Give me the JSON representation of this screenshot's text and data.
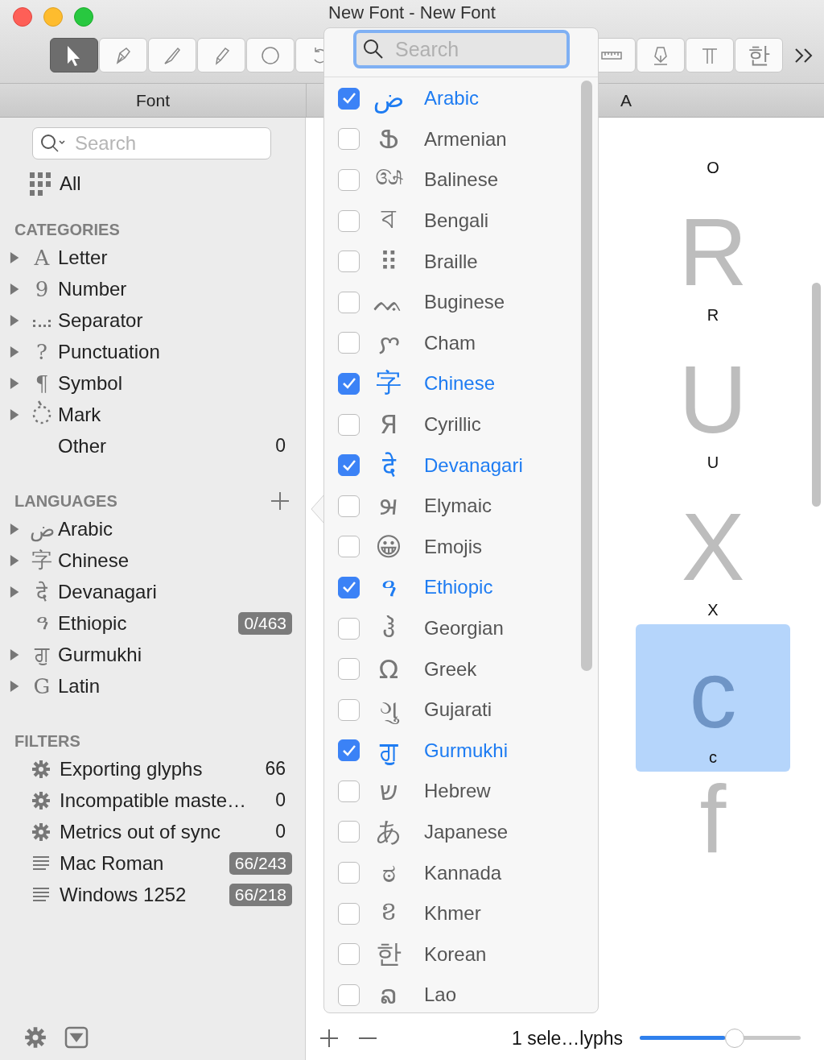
{
  "window": {
    "title": "New Font - New Font"
  },
  "toolbar": {
    "tools": [
      {
        "selected": true
      },
      {
        "selected": false
      },
      {
        "selected": false
      },
      {
        "selected": false
      },
      {
        "selected": false
      },
      {
        "selected": false
      },
      {
        "selected": false
      },
      {
        "selected": false
      },
      {
        "selected": false
      },
      {
        "glyph": "한",
        "selected": false
      }
    ]
  },
  "header": {
    "sidebar_title": "Font",
    "column_title": "A"
  },
  "sidebar": {
    "search": {
      "placeholder": "Search"
    },
    "all": {
      "label": "All"
    },
    "categories": {
      "title": "CATEGORIES",
      "items": [
        {
          "glyph": "A",
          "label": "Letter",
          "expanded": false
        },
        {
          "glyph": "9",
          "label": "Number",
          "expanded": false
        },
        {
          "label": "Separator",
          "expanded": false
        },
        {
          "glyph": "?",
          "label": "Punctuation",
          "expanded": false
        },
        {
          "glyph": "¶",
          "label": "Symbol",
          "expanded": false
        },
        {
          "label": "Mark",
          "expanded": false
        },
        {
          "label": "Other",
          "count": "0"
        }
      ]
    },
    "languages": {
      "title": "LANGUAGES",
      "items": [
        {
          "glyph": "ض",
          "label": "Arabic",
          "expanded": false
        },
        {
          "glyph": "字",
          "label": "Chinese",
          "expanded": false
        },
        {
          "glyph": "दे",
          "label": "Devanagari",
          "expanded": false
        },
        {
          "glyph": "ዓ",
          "label": "Ethiopic",
          "badge": "0/463"
        },
        {
          "glyph": "ਗੁ",
          "label": "Gurmukhi",
          "expanded": false
        },
        {
          "glyph": "G",
          "label": "Latin",
          "expanded": false
        }
      ]
    },
    "filters": {
      "title": "FILTERS",
      "items": [
        {
          "kind": "filter",
          "label": "Exporting glyphs",
          "count": "66"
        },
        {
          "kind": "filter",
          "label": "Incompatible maste…",
          "count": "0"
        },
        {
          "kind": "filter",
          "label": "Metrics out of sync",
          "count": "0"
        },
        {
          "kind": "encoding",
          "label": "Mac Roman",
          "badge": "66/243"
        },
        {
          "kind": "encoding",
          "label": "Windows 1252",
          "badge": "66/218"
        }
      ]
    }
  },
  "glyphs": [
    {
      "name": "O",
      "selected": false
    },
    {
      "glyph": "R",
      "name": "R",
      "selected": false
    },
    {
      "glyph": "U",
      "name": "U",
      "selected": false
    },
    {
      "glyph": "X",
      "name": "X",
      "selected": false
    },
    {
      "glyph": "c",
      "name": "c",
      "selected": true
    },
    {
      "glyph": "f",
      "selected": false
    }
  ],
  "status_bar": {
    "text": "1 sele…lyphs",
    "zoom": {
      "level": 0.59
    }
  },
  "popover": {
    "search": {
      "placeholder": "Search"
    },
    "scripts": [
      {
        "glyph": "ض",
        "name": "Arabic",
        "checked": true
      },
      {
        "glyph": "Ֆ",
        "name": "Armenian",
        "checked": false
      },
      {
        "glyph": "ᬅ",
        "name": "Balinese",
        "checked": false
      },
      {
        "glyph": "ব",
        "name": "Bengali",
        "checked": false
      },
      {
        "glyph": "⠿",
        "name": "Braille",
        "checked": false
      },
      {
        "glyph": "ᨕ",
        "name": "Buginese",
        "checked": false
      },
      {
        "glyph": "ꨆ",
        "name": "Cham",
        "checked": false
      },
      {
        "glyph": "字",
        "name": "Chinese",
        "checked": true
      },
      {
        "glyph": "Я",
        "name": "Cyrillic",
        "checked": false
      },
      {
        "glyph": "दे",
        "name": "Devanagari",
        "checked": true
      },
      {
        "glyph": "𐿤",
        "name": "Elymaic",
        "checked": false
      },
      {
        "glyph": "😀",
        "name": "Emojis",
        "checked": false
      },
      {
        "glyph": "ዓ",
        "name": "Ethiopic",
        "checked": true
      },
      {
        "glyph": "ჰ",
        "name": "Georgian",
        "checked": false
      },
      {
        "glyph": "Ω",
        "name": "Greek",
        "checked": false
      },
      {
        "glyph": "ગુ",
        "name": "Gujarati",
        "checked": false
      },
      {
        "glyph": "ਗੁ",
        "name": "Gurmukhi",
        "checked": true
      },
      {
        "glyph": "ש",
        "name": "Hebrew",
        "checked": false
      },
      {
        "glyph": "あ",
        "name": "Japanese",
        "checked": false
      },
      {
        "glyph": "ಠ",
        "name": "Kannada",
        "checked": false
      },
      {
        "glyph": "ខ",
        "name": "Khmer",
        "checked": false
      },
      {
        "glyph": "한",
        "name": "Korean",
        "checked": false
      },
      {
        "glyph": "ລ",
        "name": "Lao",
        "checked": false
      }
    ]
  }
}
